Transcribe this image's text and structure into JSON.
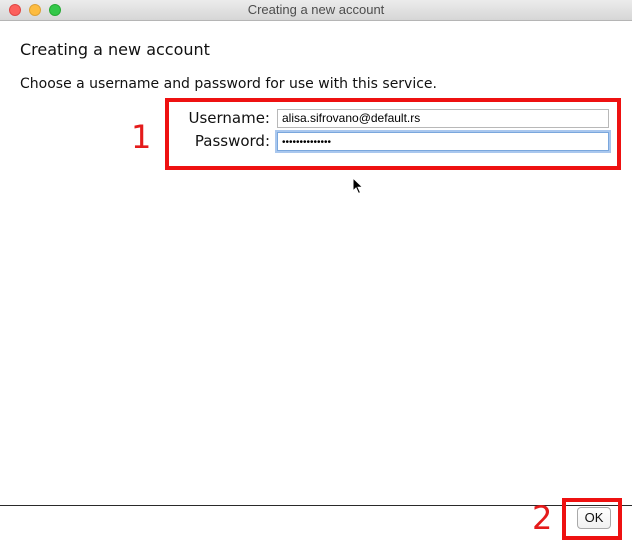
{
  "window": {
    "title": "Creating a new account"
  },
  "content": {
    "heading": "Creating a new account",
    "description": "Choose a username and password for use with this service."
  },
  "form": {
    "username_label": "Username:",
    "username_value": "alisa.sifrovano@default.rs",
    "password_label": "Password:",
    "password_masked": "••••••••••••••",
    "password_focused": true
  },
  "footer": {
    "ok_label": "OK"
  },
  "annotations": {
    "box1_number": "1",
    "box2_number": "2",
    "color": "#ee1111"
  },
  "icons": {
    "close": "close-icon",
    "minimize": "minimize-icon",
    "maximize": "maximize-icon",
    "cursor": "mouse-pointer-icon"
  }
}
